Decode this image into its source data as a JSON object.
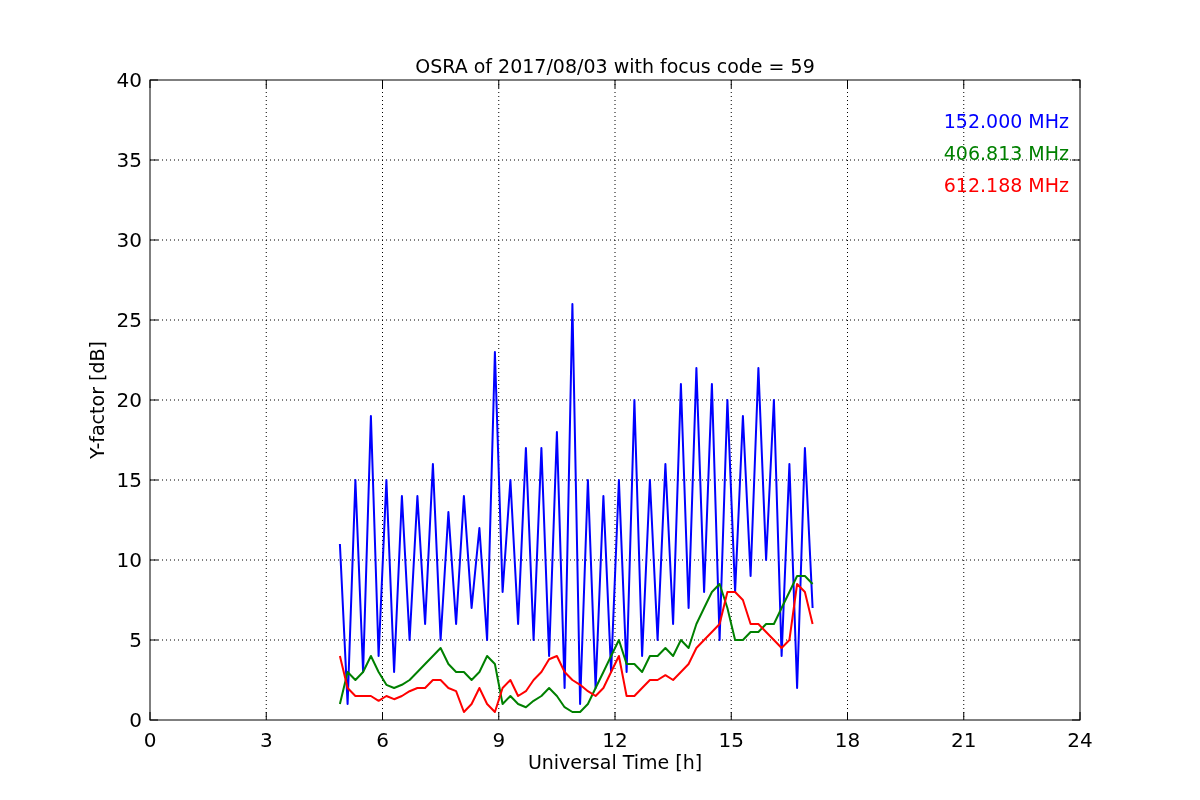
{
  "chart_data": {
    "type": "line",
    "title": "OSRA of 2017/08/03 with focus code = 59",
    "xlabel": "Universal Time [h]",
    "ylabel": "Y-factor [dB]",
    "grid": true,
    "xlim": [
      0,
      24
    ],
    "ylim": [
      0,
      40
    ],
    "xticks": [
      0,
      3,
      6,
      9,
      12,
      15,
      18,
      21,
      24
    ],
    "yticks": [
      0,
      5,
      10,
      15,
      20,
      25,
      30,
      35,
      40
    ],
    "x": [
      4.9,
      5.1,
      5.3,
      5.5,
      5.7,
      5.9,
      6.1,
      6.3,
      6.5,
      6.7,
      6.9,
      7.1,
      7.3,
      7.5,
      7.7,
      7.9,
      8.1,
      8.3,
      8.5,
      8.7,
      8.9,
      9.1,
      9.3,
      9.5,
      9.7,
      9.9,
      10.1,
      10.3,
      10.5,
      10.7,
      10.9,
      11.1,
      11.3,
      11.5,
      11.7,
      11.9,
      12.1,
      12.3,
      12.5,
      12.7,
      12.9,
      13.1,
      13.3,
      13.5,
      13.7,
      13.9,
      14.1,
      14.3,
      14.5,
      14.7,
      14.9,
      15.1,
      15.3,
      15.5,
      15.7,
      15.9,
      16.1,
      16.3,
      16.5,
      16.7,
      16.9,
      17.1
    ],
    "series": [
      {
        "name": "152.000 MHz",
        "color": "#0000ff",
        "values": [
          11,
          1,
          15,
          3,
          19,
          4,
          15,
          3,
          14,
          5,
          14,
          6,
          16,
          5,
          13,
          6,
          14,
          7,
          12,
          5,
          23,
          8,
          15,
          6,
          17,
          5,
          17,
          4,
          18,
          2,
          26,
          1,
          15,
          2,
          14,
          3,
          15,
          3,
          20,
          4,
          15,
          5,
          16,
          6,
          21,
          7,
          22,
          8,
          21,
          5,
          20,
          8,
          19,
          9,
          22,
          10,
          20,
          4,
          16,
          2,
          17,
          7
        ]
      },
      {
        "name": "406.813 MHz",
        "color": "#008000",
        "values": [
          1,
          3,
          2.5,
          3,
          4,
          3,
          2.2,
          2,
          2.2,
          2.5,
          3,
          3.5,
          4,
          4.5,
          3.5,
          3,
          3,
          2.5,
          3,
          4,
          3.5,
          1,
          1.5,
          1,
          0.8,
          1.2,
          1.5,
          2,
          1.5,
          0.8,
          0.5,
          0.5,
          1,
          2,
          3,
          4,
          5,
          3.5,
          3.5,
          3,
          4,
          4,
          4.5,
          4,
          5,
          4.5,
          6,
          7,
          8,
          8.5,
          7,
          5,
          5,
          5.5,
          5.5,
          6,
          6,
          7,
          8,
          9,
          9,
          8.5
        ]
      },
      {
        "name": "612.188 MHz",
        "color": "#ff0000",
        "values": [
          4,
          2,
          1.5,
          1.5,
          1.5,
          1.2,
          1.5,
          1.3,
          1.5,
          1.8,
          2,
          2,
          2.5,
          2.5,
          2,
          1.8,
          0.5,
          1,
          2,
          1,
          0.5,
          2,
          2.5,
          1.5,
          1.8,
          2.5,
          3,
          3.8,
          4,
          3,
          2.5,
          2.2,
          1.8,
          1.5,
          2,
          3,
          4,
          1.5,
          1.5,
          2,
          2.5,
          2.5,
          2.8,
          2.5,
          3,
          3.5,
          4.5,
          5,
          5.5,
          6,
          8,
          8,
          7.5,
          6,
          6,
          5.5,
          5,
          4.5,
          5,
          8.5,
          8,
          6
        ]
      }
    ]
  }
}
